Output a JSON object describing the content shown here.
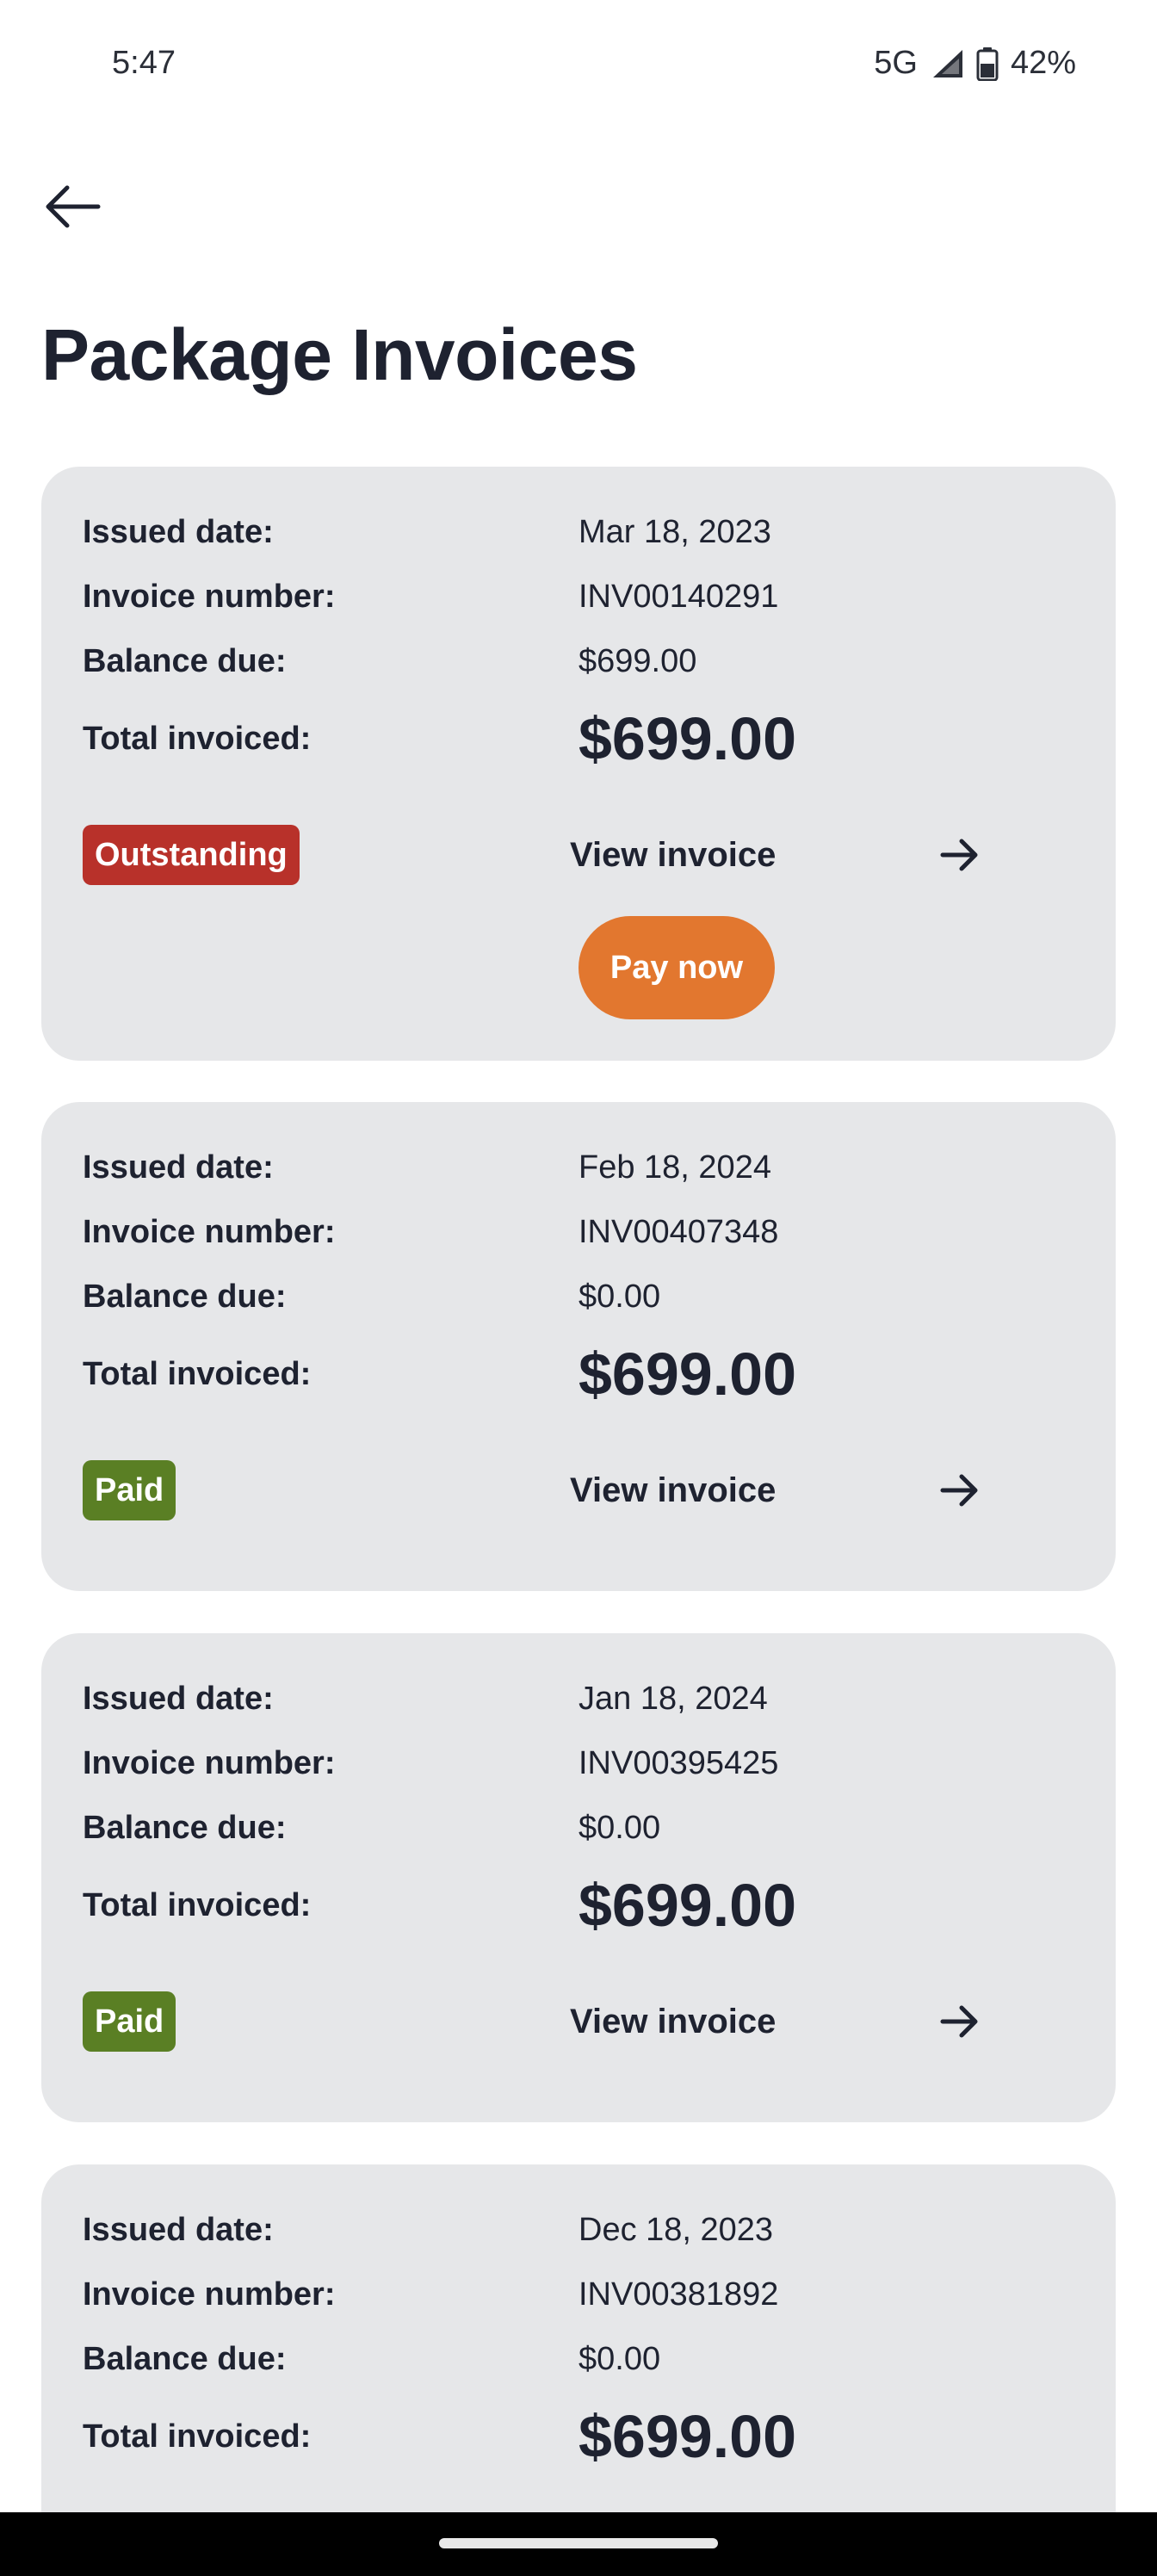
{
  "status_bar": {
    "time": "5:47",
    "network": "5G",
    "battery": "42%"
  },
  "header": {
    "back_icon": "arrow-left-icon",
    "title": "Package Invoices"
  },
  "labels": {
    "issued_date": "Issued date:",
    "invoice_number": "Invoice number:",
    "balance_due": "Balance due:",
    "total_invoiced": "Total invoiced:",
    "view_invoice": "View invoice",
    "pay_now": "Pay now"
  },
  "invoices": [
    {
      "issued_date": "Mar 18, 2023",
      "invoice_number": "INV00140291",
      "balance_due": "$699.00",
      "total_invoiced": "$699.00",
      "status": "Outstanding",
      "status_color": "#b8312a"
    },
    {
      "issued_date": "Feb 18, 2024",
      "invoice_number": "INV00407348",
      "balance_due": "$0.00",
      "total_invoiced": "$699.00",
      "status": "Paid",
      "status_color": "#5a7f24"
    },
    {
      "issued_date": "Jan 18, 2024",
      "invoice_number": "INV00395425",
      "balance_due": "$0.00",
      "total_invoiced": "$699.00",
      "status": "Paid",
      "status_color": "#5a7f24"
    },
    {
      "issued_date": "Dec 18, 2023",
      "invoice_number": "INV00381892",
      "balance_due": "$0.00",
      "total_invoiced": "$699.00"
    }
  ],
  "colors": {
    "card_bg": "#e6e7e9",
    "pay_button": "#e2772f",
    "text": "#1e2230"
  }
}
